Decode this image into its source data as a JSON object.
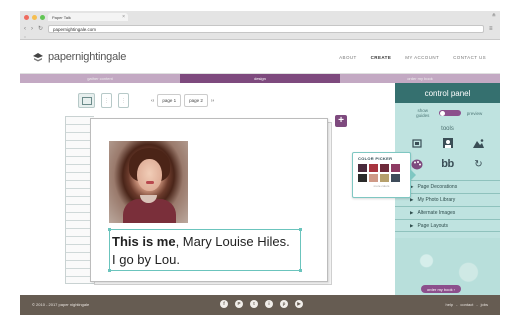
{
  "browser": {
    "tab_title": "Paper Talk",
    "url": "papernightingale.com",
    "bookmarks": "::",
    "traffic_lights": [
      "#ef6b5e",
      "#f6be4f",
      "#61c554"
    ]
  },
  "header": {
    "logo_text": "papernightingale",
    "nav": [
      "ABOUT",
      "CREATE",
      "MY ACCOUNT",
      "CONTACT US"
    ],
    "active_nav": "CREATE"
  },
  "steps": [
    "gather content",
    "design",
    "order my book"
  ],
  "current_step": 1,
  "toolbar": {
    "page_prev": "‹‹",
    "page_1": "page 1",
    "page_2": "page 2",
    "page_next": "››"
  },
  "caption": {
    "bold": "This is me",
    "rest": ", Mary Louise Hiles.",
    "line2": "I go by Lou."
  },
  "panel": {
    "title": "control panel",
    "toggle_left": "show guides",
    "toggle_right": "preview",
    "tools_title": "tools",
    "tools": [
      "crop-icon",
      "portrait-icon",
      "landscape-icon",
      "palette-icon",
      "text-size-icon",
      "undo-icon"
    ],
    "text_tool_label": "bb",
    "menu": [
      "Page Decorations",
      "My Photo Library",
      "Alternate Images",
      "Page Layouts"
    ],
    "order_button": "order my book ›"
  },
  "color_picker": {
    "title": "COLOR PICKER",
    "colors": [
      "#4a2a3c",
      "#a8353f",
      "#6e2a3a",
      "#8e3b63",
      "#2a2a2a",
      "#cf9a88",
      "#b6a06c",
      "#3e4c5a"
    ],
    "more_label": "more colors"
  },
  "footer": {
    "copyright": "© 2010 - 2017 paper nightingale",
    "social": [
      "f",
      "P",
      "t",
      "i",
      "p",
      "▶"
    ],
    "links": [
      "help",
      "-",
      "contact",
      "-",
      "jobs"
    ]
  }
}
